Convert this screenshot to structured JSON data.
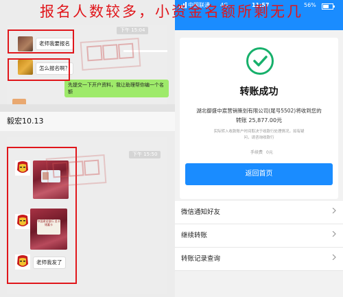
{
  "headline": "报名人数较多，小资金名额所剩无几",
  "left": {
    "chat1": {
      "time": "下午 15:04",
      "messages": [
        {
          "text": "老师我要报名"
        },
        {
          "text": "怎么报名啊？"
        }
      ],
      "reply_green": "先提交一下开户资料，我让助理帮你编一个名额"
    },
    "contact_name": "毅宏10.13",
    "chat2": {
      "time": "下午 15:50",
      "last_message": "老师我发了",
      "card_text": "中国建设银行 龙卡储蓄卡"
    },
    "watermark": "趋势通"
  },
  "right": {
    "status": {
      "carrier": "中国联通",
      "network": "4G",
      "time": "11:57",
      "battery": "56%"
    },
    "title": "转账成功",
    "recipient_line": "湖北御盛中宸营销策划有限公司(尾号5502)将收到您的",
    "amount_line": "转账 25,877.00元",
    "note_line1": "实际转入收款账户时间取决于收款行处理情况，如有疑",
    "note_line2": "问，请咨询收款行",
    "fee_label": "手续费",
    "fee_value": "0元",
    "back_button": "返回首页",
    "menu": [
      {
        "label": "微信通知好友"
      },
      {
        "label": "继续转账"
      },
      {
        "label": "转账记录查询"
      }
    ]
  },
  "colors": {
    "accent_red": "#e0151a",
    "blue": "#1a8cff",
    "success_green": "#17b06b",
    "wechat_green": "#9eea6a"
  }
}
